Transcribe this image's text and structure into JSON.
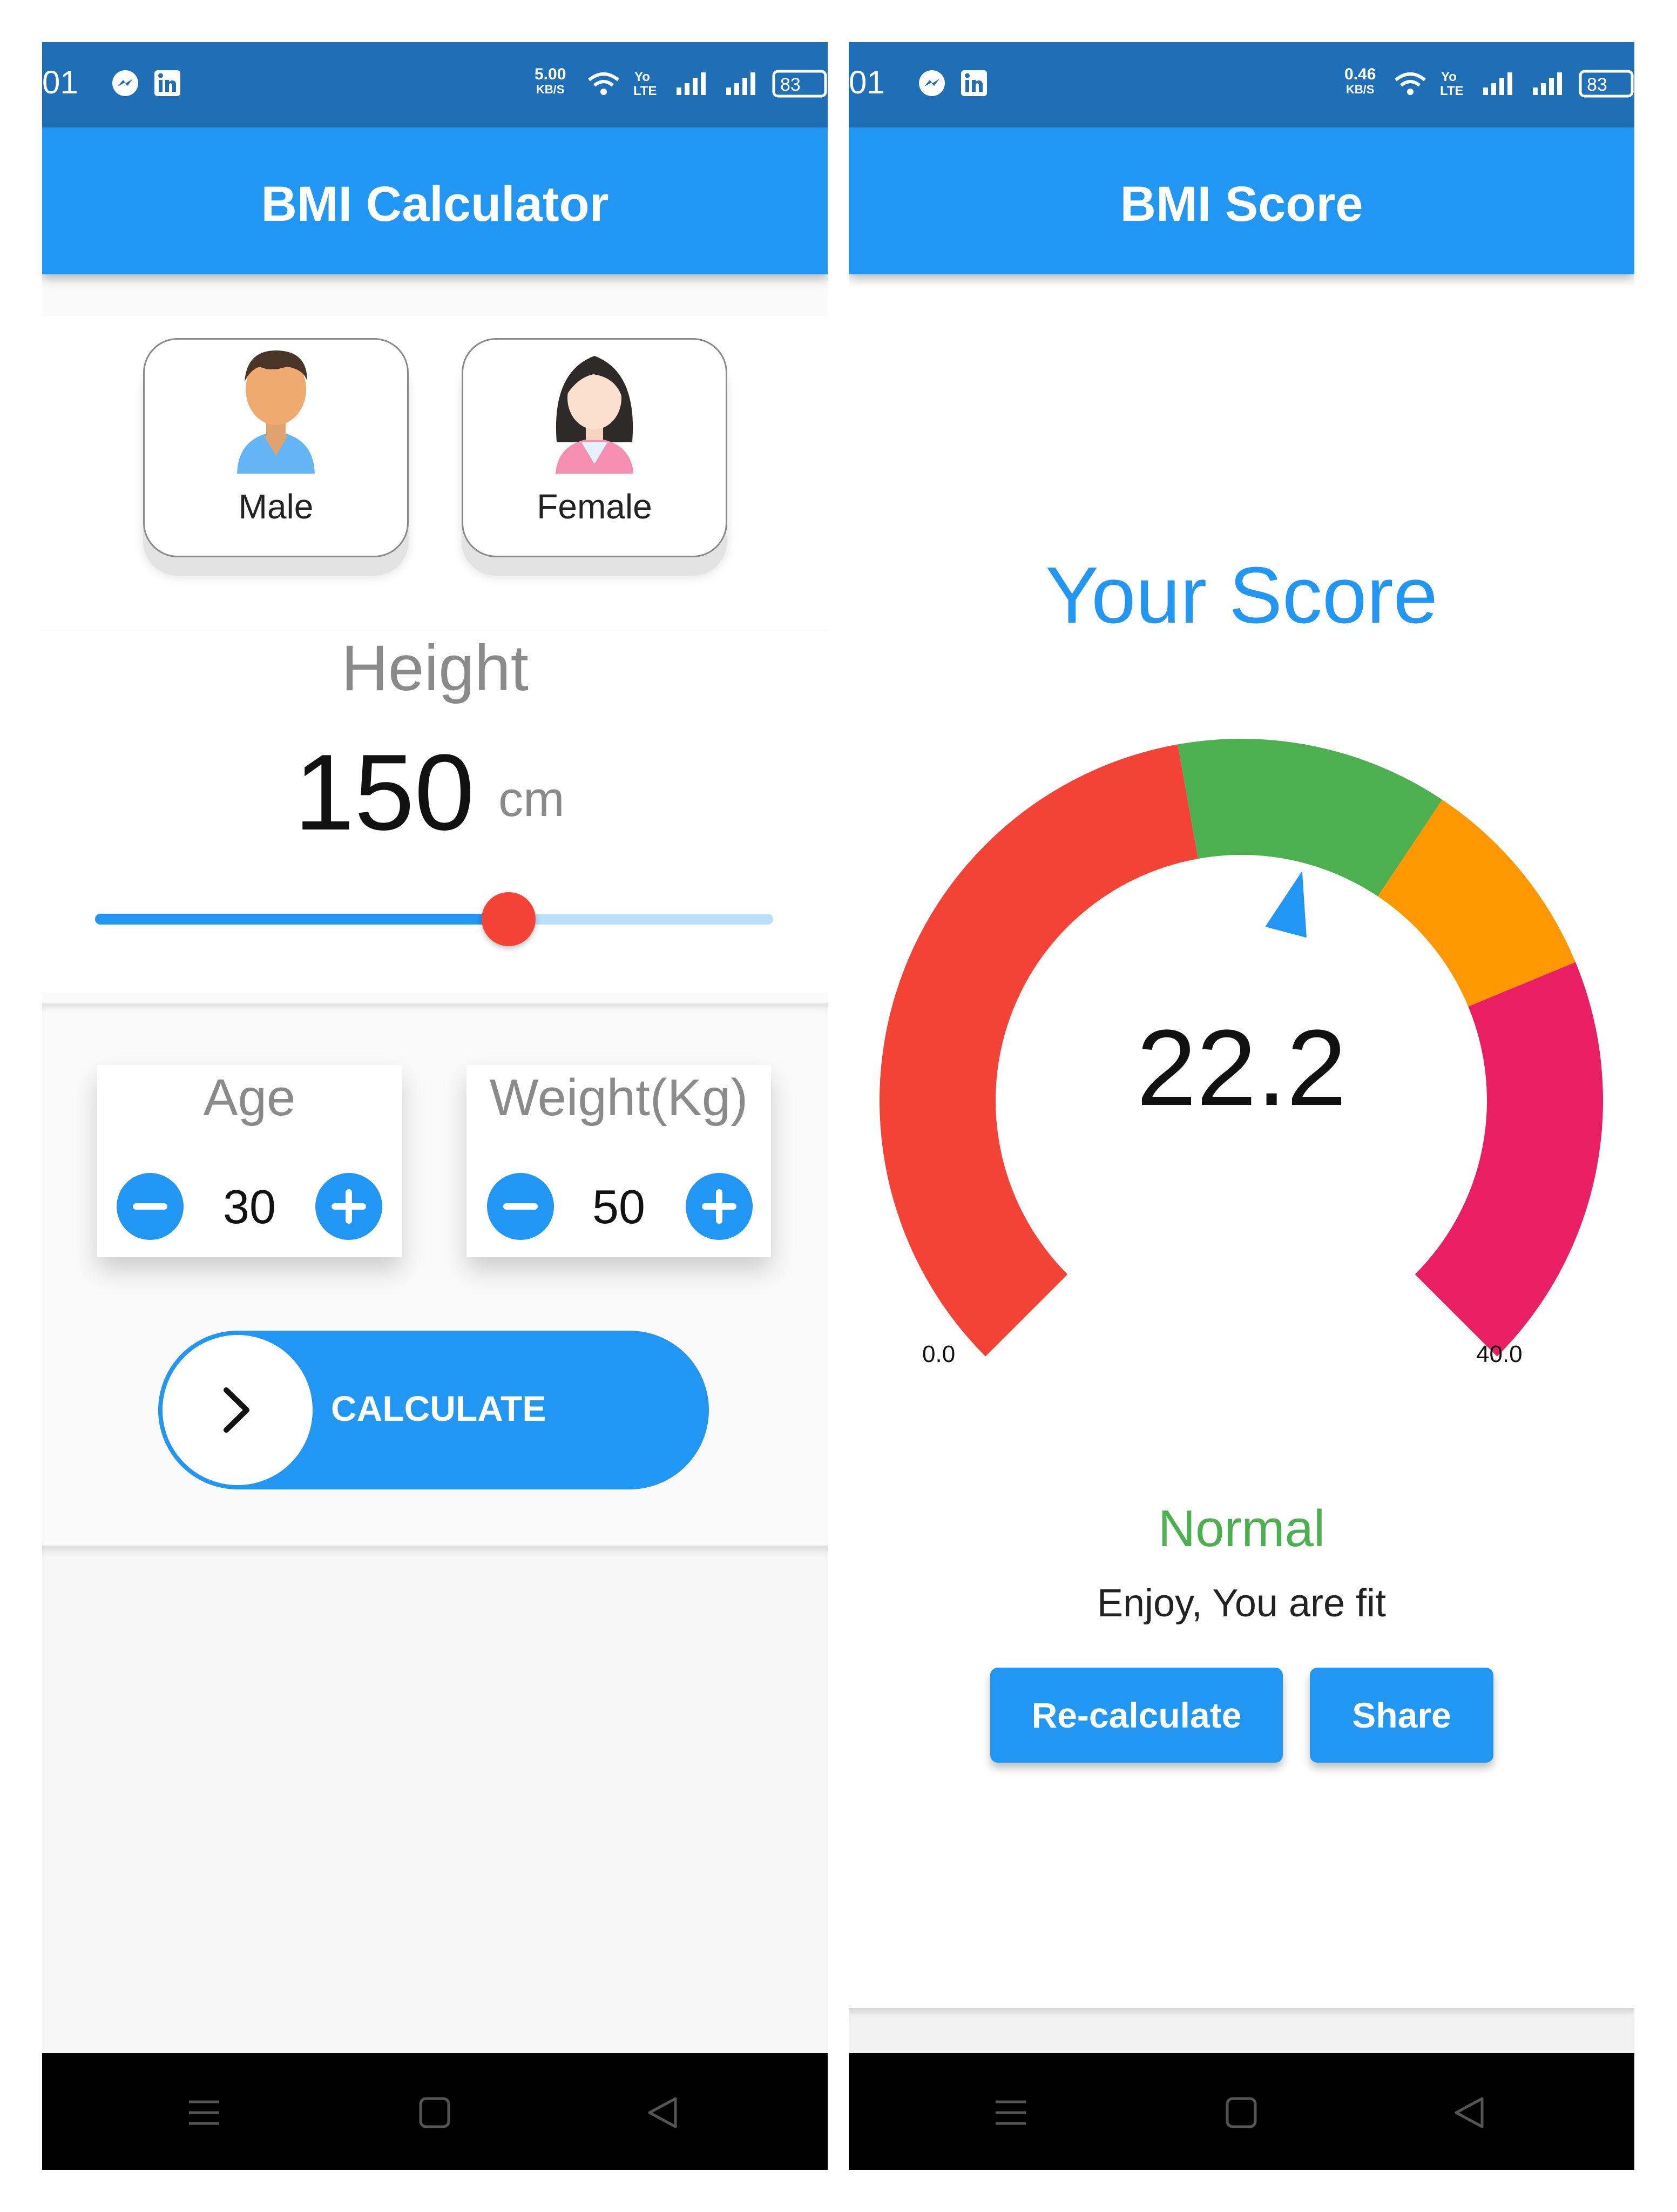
{
  "left": {
    "status_bar": {
      "time": "01",
      "speed_value": "5.00",
      "speed_unit": "KB/S",
      "volte": "Yo LTE",
      "battery": "83"
    },
    "app_bar": {
      "title": "BMI Calculator"
    },
    "gender": {
      "male_label": "Male",
      "female_label": "Female"
    },
    "height": {
      "title": "Height",
      "value": "150",
      "unit": "cm",
      "slider_fraction": 0.61
    },
    "age": {
      "title": "Age",
      "value": "30"
    },
    "weight": {
      "title": "Weight(Kg)",
      "value": "50"
    },
    "calculate": {
      "label": "CALCULATE"
    }
  },
  "right": {
    "status_bar": {
      "time": "01",
      "speed_value": "0.46",
      "speed_unit": "KB/S",
      "volte": "Yo LTE",
      "battery": "83"
    },
    "app_bar": {
      "title": "BMI Score"
    },
    "score_title": "Your Score",
    "gauge": {
      "min_label": "0.0",
      "max_label": "40.0",
      "min": 0,
      "max": 40,
      "value": 22.2,
      "segments": [
        {
          "from": 0,
          "to": 18.5,
          "color": "#f44336"
        },
        {
          "from": 18.5,
          "to": 25,
          "color": "#4caf50"
        },
        {
          "from": 25,
          "to": 30,
          "color": "#ff9800"
        },
        {
          "from": 30,
          "to": 40,
          "color": "#e91e63"
        }
      ],
      "needle_color": "#2196f3"
    },
    "score_value": "22.2",
    "status": "Normal",
    "message": "Enjoy, You are fit",
    "buttons": {
      "recalculate": "Re-calculate",
      "share": "Share"
    }
  },
  "colors": {
    "primary": "#2196f3",
    "status_bar": "#1f6fb6",
    "accent": "#f44336",
    "normal": "#4caf50"
  },
  "icons": [
    "messenger-icon",
    "linkedin-icon",
    "wifi-icon",
    "signal-icon",
    "battery-icon",
    "minus-icon",
    "plus-icon",
    "chevron-right-icon",
    "menu-icon",
    "home-icon",
    "back-icon"
  ]
}
